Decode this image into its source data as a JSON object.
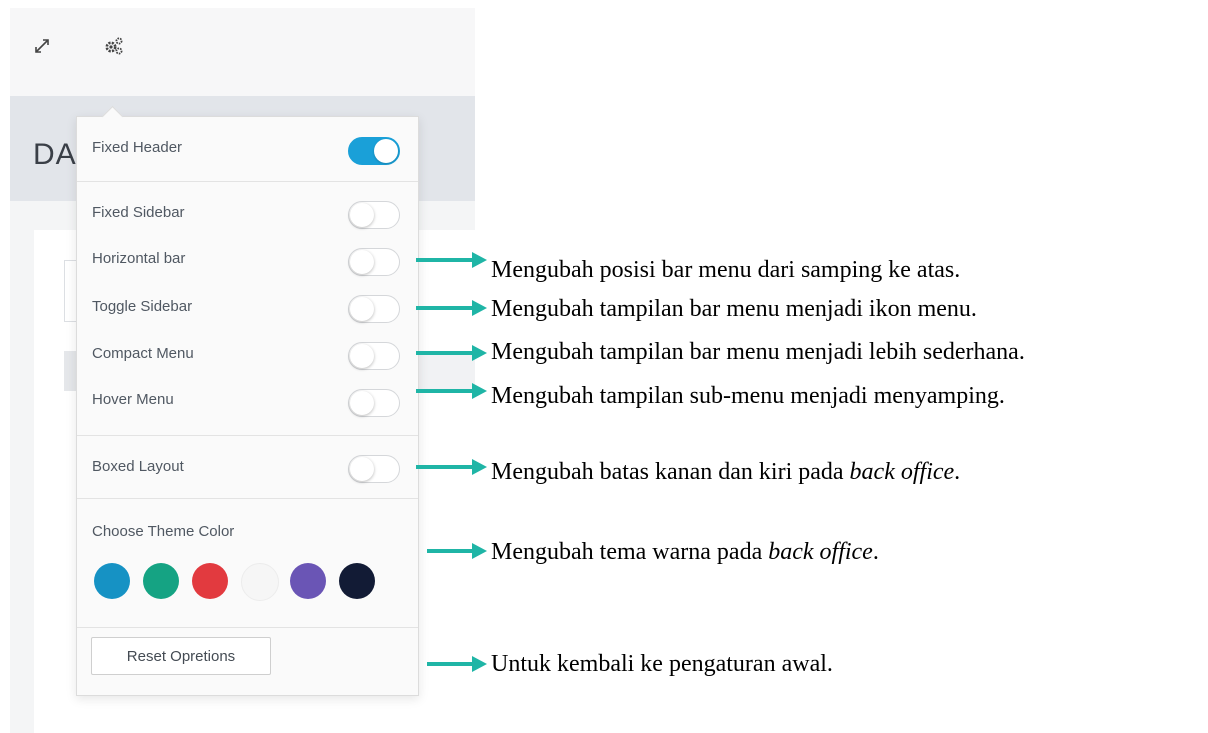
{
  "header": {
    "page_title": "DA",
    "icons": [
      "expand-icon",
      "gears-icon"
    ]
  },
  "settings_panel": {
    "options": [
      {
        "label": "Fixed Header",
        "on": true
      },
      {
        "label": "Fixed Sidebar",
        "on": false
      },
      {
        "label": "Horizontal bar",
        "on": false
      },
      {
        "label": "Toggle Sidebar",
        "on": false
      },
      {
        "label": "Compact Menu",
        "on": false
      },
      {
        "label": "Hover Menu",
        "on": false
      },
      {
        "label": "Boxed Layout",
        "on": false
      }
    ],
    "theme_label": "Choose Theme Color",
    "theme_colors": [
      "#1692c4",
      "#15a383",
      "#e23a3f",
      "#f6f6f6",
      "#6a55b5",
      "#121b35"
    ],
    "reset_label": "Reset Opretions"
  },
  "annotations": {
    "arrow_color": "#1fb5a6",
    "horizontal_bar": "Mengubah posisi bar menu dari samping ke atas.",
    "toggle_sidebar": "Mengubah tampilan bar menu menjadi ikon menu.",
    "compact_menu": "Mengubah tampilan bar menu menjadi lebih sederhana.",
    "hover_menu": "Mengubah tampilan sub-menu menjadi menyamping.",
    "boxed_layout_prefix": "Mengubah batas kanan dan kiri pada ",
    "boxed_layout_italic": "back office",
    "boxed_layout_suffix": ".",
    "theme_color_prefix": "Mengubah tema warna pada ",
    "theme_color_italic": "back office",
    "theme_color_suffix": ".",
    "reset": "Untuk kembali ke pengaturan awal."
  }
}
